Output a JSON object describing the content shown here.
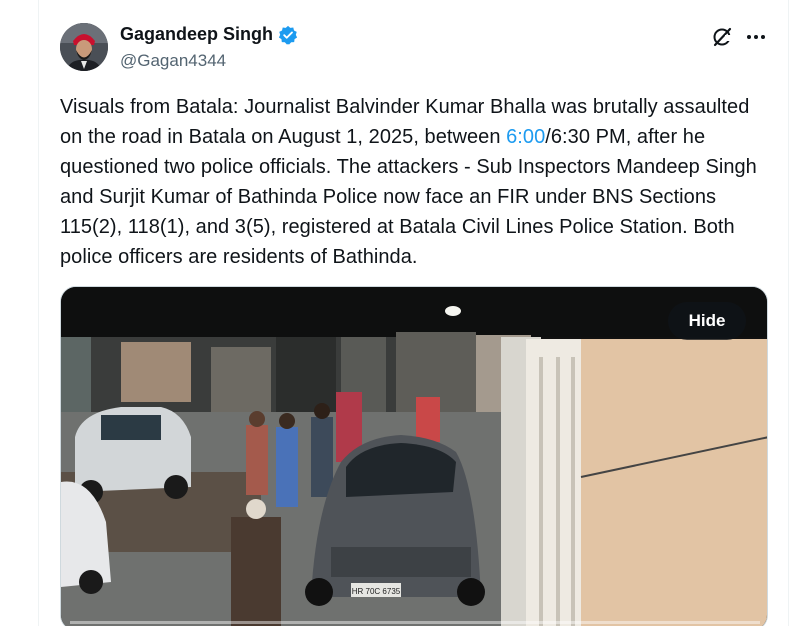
{
  "author": {
    "name": "Gagandeep Singh",
    "handle": "@Gagan4344",
    "verified_badge_icon": "verified-badge-icon",
    "avatar_icon": "avatar"
  },
  "actions": {
    "grok_icon": "grok-icon",
    "more_icon": "more-icon"
  },
  "tweet": {
    "text_part1": "Visuals from Batala: Journalist Balvinder Kumar Bhalla was brutally assaulted on the road in Batala on August 1, 2025, between ",
    "link_text": "6:00",
    "text_part2": "/6:30 PM, after he questioned two police officials. The attackers - Sub Inspectors Mandeep Singh and Surjit Kumar of Bathinda Police now face an FIR under BNS Sections 115(2), 118(1), and 3(5), registered at Batala Civil Lines Police Station. Both police officers are residents of Bathinda."
  },
  "media": {
    "hide_label": "Hide",
    "plate_text": "HR 70C 6735"
  },
  "colors": {
    "link": "#1d9bf0",
    "text": "#0f1419",
    "muted": "#536471",
    "verified": "#1d9bf0"
  }
}
